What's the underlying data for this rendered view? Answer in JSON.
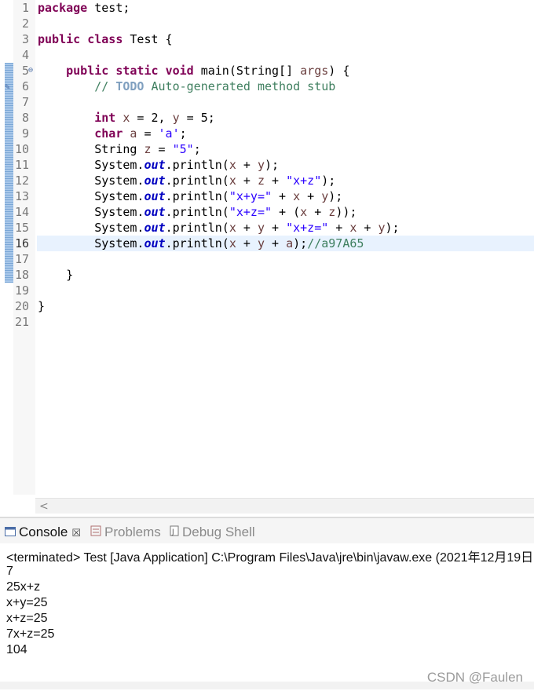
{
  "editor": {
    "line_numbers": [
      "1",
      "2",
      "3",
      "4",
      "5",
      "6",
      "7",
      "8",
      "9",
      "10",
      "11",
      "12",
      "13",
      "14",
      "15",
      "16",
      "17",
      "18",
      "19",
      "20",
      "21"
    ],
    "current_line": "16"
  },
  "console": {
    "tabs": {
      "console": "Console",
      "problems": "Problems",
      "debug_shell": "Debug Shell"
    },
    "terminated": "<terminated> Test [Java Application] C:\\Program Files\\Java\\jre\\bin\\javaw.exe (2021年12月19日",
    "output": [
      "7",
      "25x+z",
      "x+y=25",
      "x+z=25",
      "7x+z=25",
      "104"
    ]
  },
  "watermark": "CSDN @Faulen",
  "colors": {
    "keyword": "#7f0055",
    "string": "#2a00ff",
    "comment": "#3f7f5f",
    "field": "#0000c0",
    "current_line_bg": "#e8f2fe"
  }
}
